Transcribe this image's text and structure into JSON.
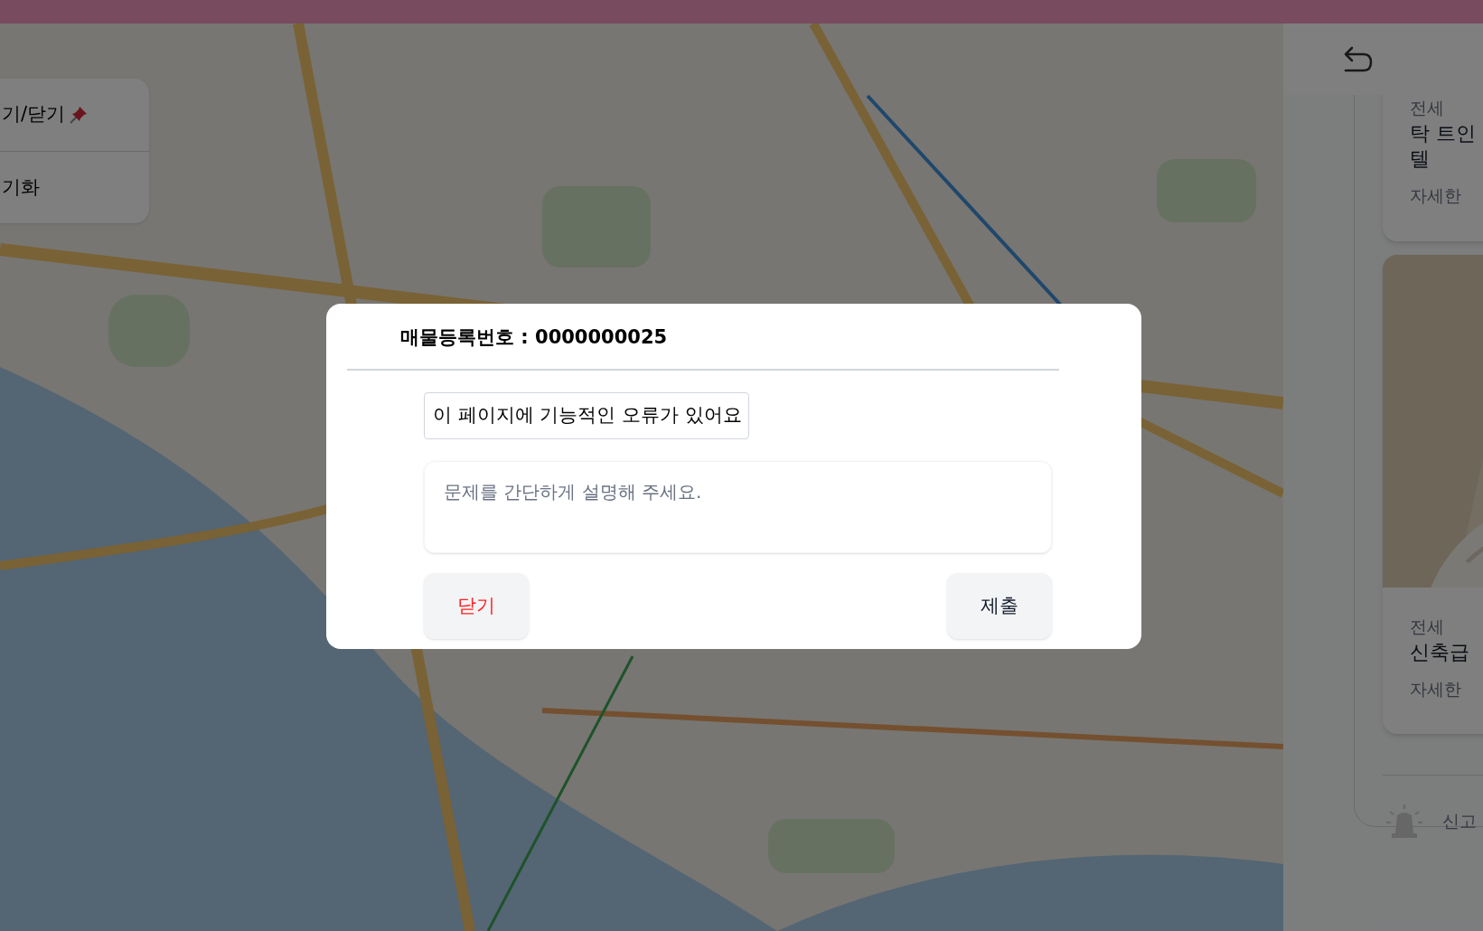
{
  "side_menu": {
    "items": [
      {
        "label": "기/닫기",
        "kind": "pin"
      },
      {
        "label": "기화",
        "kind": "plain"
      }
    ]
  },
  "listing_panel": {
    "cards": [
      {
        "kind": "text",
        "deal_type": "전세",
        "title_lines": [
          "탁 트인",
          "텔"
        ],
        "link": "자세한"
      },
      {
        "deal_type": "전세",
        "title_lines": [
          "신축급"
        ],
        "link": "자세한"
      }
    ],
    "report": "신고"
  },
  "dialog": {
    "title": "매물등록번호 : 0000000025",
    "reason": "이 페이지에 기능적인 오류가 있어요",
    "description": {
      "placeholder": "문제를 간단하게 설명해 주세요."
    },
    "buttons": [
      {
        "label": "닫기",
        "kind": "cancel"
      },
      {
        "label": "제출",
        "kind": "submit"
      }
    ]
  }
}
